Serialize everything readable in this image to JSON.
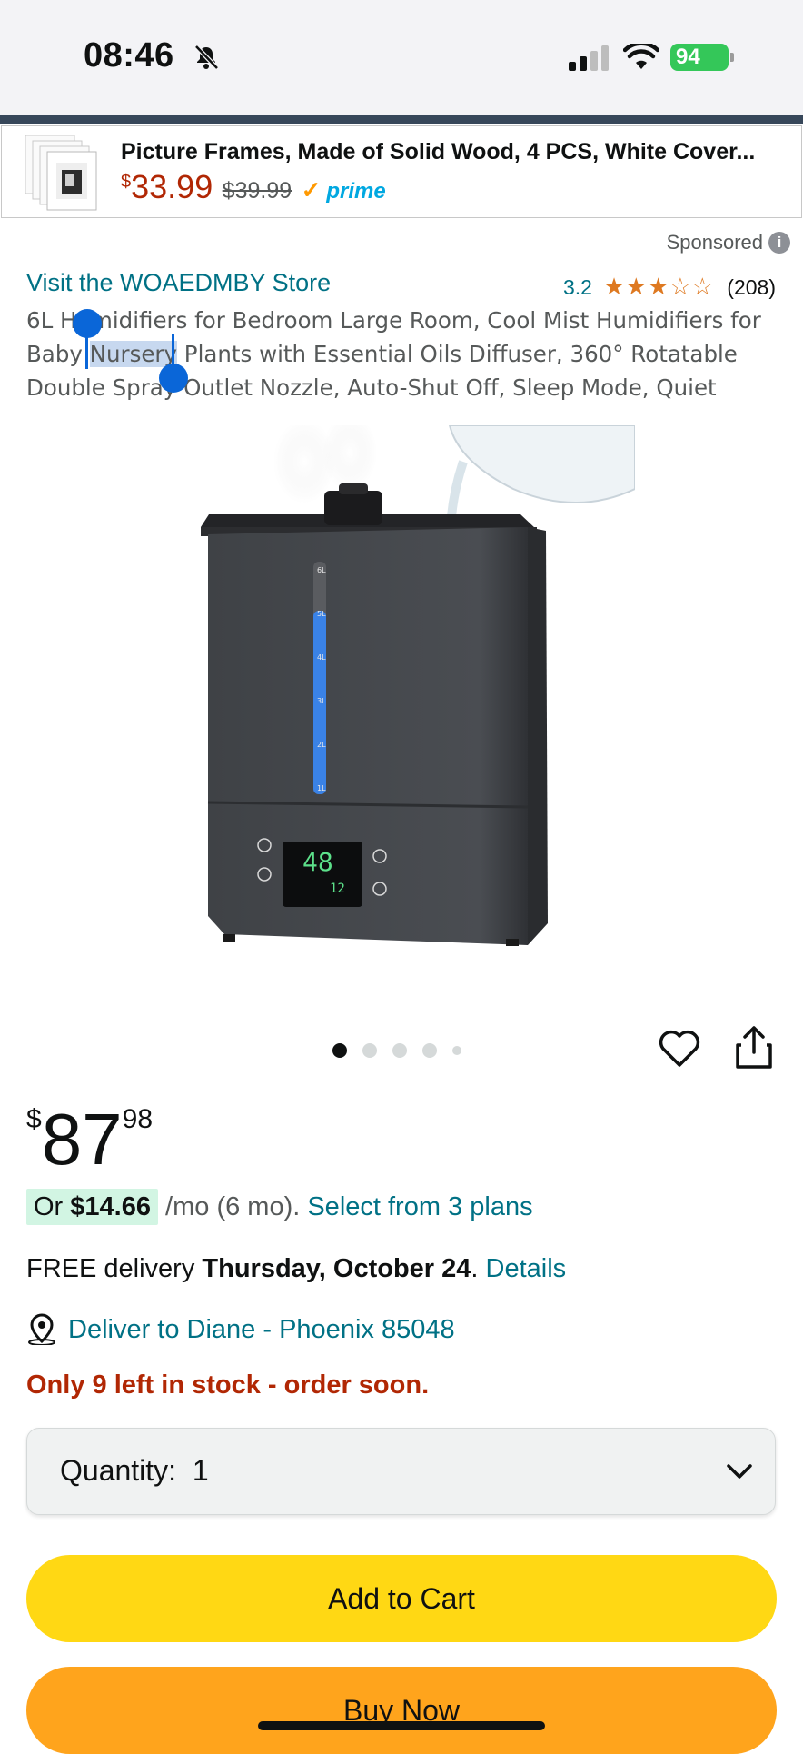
{
  "status_bar": {
    "time": "08:46",
    "battery": "94",
    "icons": [
      "bell-slash-icon",
      "cellular-signal-icon",
      "wifi-icon",
      "battery-charging-icon"
    ]
  },
  "sponsored_ad": {
    "title": "Picture Frames, Made of Solid Wood, 4 PCS, White Cover...",
    "price_symbol": "$",
    "price": "33.99",
    "was_price": "$39.99",
    "prime_label": "prime"
  },
  "sponsored_label": "Sponsored",
  "product": {
    "store_link": "Visit the WOAEDMBY Store",
    "rating": "3.2",
    "stars": "★★★☆☆",
    "rating_count": "(208)",
    "title_before": "6L Humidifiers for Bedroom Large Room, Cool Mist Humidifiers for Baby ",
    "title_selected": "Nursery",
    "title_after": " Plants with Essential Oils Diffuser, 360° Rotatable Double Spray Outlet Nozzle, Auto-Shut Off, Sleep Mode, Quiet",
    "display_reading_main": "48",
    "display_reading_time": "12",
    "tank_levels": [
      "6L",
      "5L",
      "4L",
      "3L",
      "2L",
      "1L"
    ],
    "water_level_liters": 5
  },
  "carousel": {
    "count": 5,
    "active_index": 0
  },
  "price": {
    "symbol": "$",
    "whole": "87",
    "fraction": "98"
  },
  "installment": {
    "prefix": "Or ",
    "amount": "$14.66",
    "suffix": " /mo (6 mo). ",
    "link": "Select from 3 plans"
  },
  "delivery": {
    "prefix": "FREE delivery ",
    "date": "Thursday, October 24",
    "sep": ". ",
    "link": "Details"
  },
  "deliver_to": "Deliver to Diane - Phoenix 85048",
  "stock": "Only 9 left in stock - order soon.",
  "quantity": {
    "label": "Quantity:",
    "value": "1"
  },
  "buttons": {
    "add_to_cart": "Add to Cart",
    "buy_now": "Buy Now"
  },
  "colors": {
    "link": "#007185",
    "deal_red": "#B12704",
    "cart_yellow": "#FFD814",
    "buy_orange": "#FFA41C",
    "star_orange": "#DE7921"
  }
}
